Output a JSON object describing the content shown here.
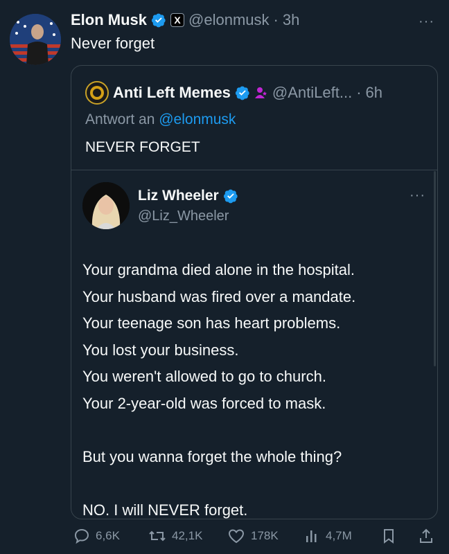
{
  "author": {
    "name": "Elon Musk",
    "handle": "@elonmusk",
    "time": "3h",
    "separator": "·",
    "badge": "X",
    "avatar_icon": "person-flag-avatar"
  },
  "tweet_text": "Never forget",
  "more_label": "···",
  "quote": {
    "name": "Anti Left Memes",
    "handle": "@AntiLeft...",
    "time": "6h",
    "separator": "·",
    "reply_prefix": "Antwort an",
    "reply_handle": "@elonmusk",
    "text": "NEVER FORGET",
    "inner": {
      "name": "Liz Wheeler",
      "handle": "@Liz_Wheeler",
      "lines": [
        "Your grandma died alone in the hospital.",
        "Your husband was fired over a mandate.",
        "Your teenage son has heart problems.",
        "You lost your business.",
        "You weren't allowed to go to church.",
        "Your 2-year-old was forced to mask.",
        "",
        "But you wanna forget the whole thing?",
        "",
        "NO. I will NEVER forget."
      ]
    }
  },
  "actions": {
    "replies": "6,6K",
    "reposts": "42,1K",
    "likes": "178K",
    "views": "4,7M"
  },
  "colors": {
    "background": "#15202b",
    "accent": "#1d9bf0",
    "muted": "#8b98a5",
    "border": "#38444d"
  }
}
